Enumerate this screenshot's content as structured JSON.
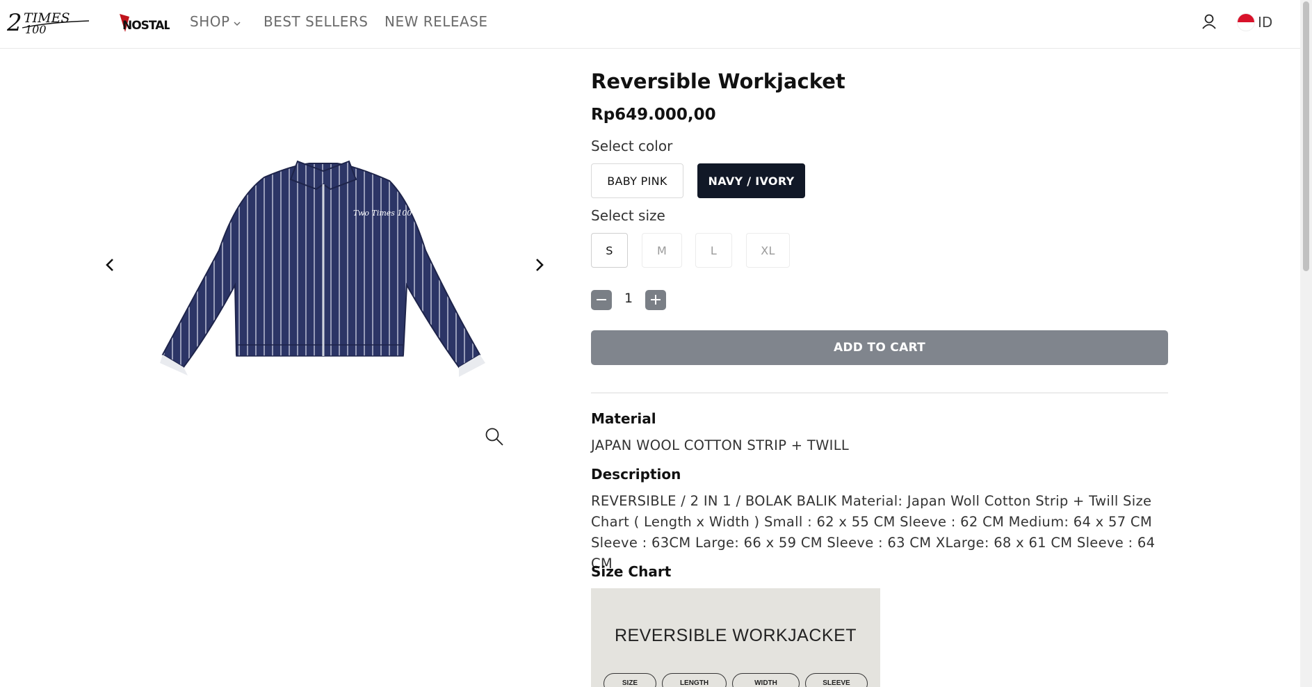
{
  "header": {
    "logo_text": "2TIMES 100",
    "sub_logo_text": "NOSTAL",
    "nav": {
      "shop": "SHOP",
      "best_sellers": "BEST SELLERS",
      "new_release": "NEW RELEASE"
    },
    "language": "ID"
  },
  "product": {
    "title": "Reversible Workjacket",
    "price": "Rp649.000,00",
    "select_color_label": "Select color",
    "colors": [
      "BABY PINK",
      "NAVY / IVORY"
    ],
    "selected_color": "NAVY / IVORY",
    "select_size_label": "Select size",
    "sizes": [
      "S",
      "M",
      "L",
      "XL"
    ],
    "available_sizes": [
      "S"
    ],
    "quantity": "1",
    "add_to_cart": "ADD TO CART"
  },
  "details": {
    "material_heading": "Material",
    "material_text": "JAPAN WOOL COTTON STRIP + TWILL",
    "description_heading": "Description",
    "description_text": "REVERSIBLE / 2 IN 1 / BOLAK BALIK Material: Japan Woll Cotton Strip + Twill Size Chart ( Length x Width ) Small : 62 x 55 CM Sleeve : 62 CM Medium: 64 x 57 CM Sleeve : 63CM Large: 66 x 59 CM Sleeve : 63 CM XLarge: 68 x 61 CM Sleeve : 64 CM",
    "size_chart_heading": "Size Chart",
    "size_chart_image": {
      "title": "REVERSIBLE WORKJACKET",
      "columns": [
        "SIZE",
        "LENGTH",
        "WIDTH",
        "SLEEVE"
      ]
    }
  },
  "colors": {
    "selected_option_bg": "#111827",
    "cart_button_bg": "#80858d",
    "qty_button_bg": "#7a7f86",
    "jacket_navy": "#2c3566",
    "flag_red": "#d8122a"
  },
  "icons": {
    "user": "user-icon",
    "search": "search-icon",
    "prev": "chevron-left-icon",
    "next": "chevron-right-icon"
  }
}
